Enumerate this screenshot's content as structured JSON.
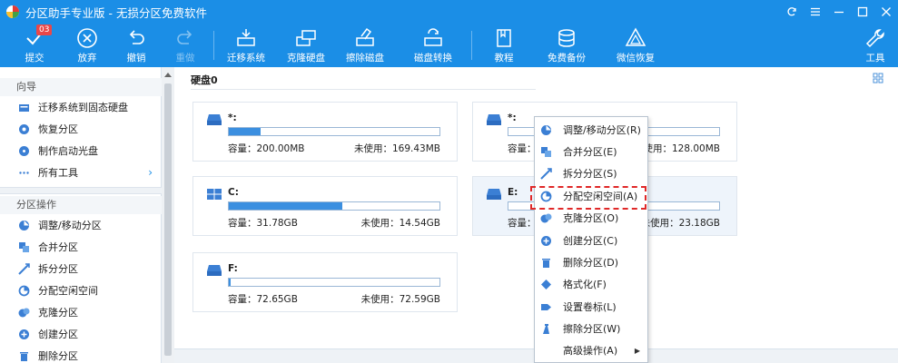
{
  "window": {
    "title": "分区助手专业版 - 无损分区免费软件",
    "accent": "#1b8ee6"
  },
  "toolbar": {
    "commit_label": "提交",
    "commit_badge": "03",
    "discard_label": "放弃",
    "undo_label": "撤销",
    "redo_label": "重做",
    "migrate_label": "迁移系统",
    "clone_disk_label": "克隆硬盘",
    "wipe_disk_label": "擦除磁盘",
    "disk_convert_label": "磁盘转换",
    "tutorial_label": "教程",
    "backup_label": "免费备份",
    "wechat_label": "微信恢复",
    "tools_label": "工具"
  },
  "sidebar": {
    "wizard_title": "向导",
    "wizard_items": [
      {
        "label": "迁移系统到固态硬盘",
        "icon": "migrate-icon"
      },
      {
        "label": "恢复分区",
        "icon": "recover-icon"
      },
      {
        "label": "制作启动光盘",
        "icon": "disc-icon"
      },
      {
        "label": "所有工具",
        "icon": "more-icon"
      }
    ],
    "ops_title": "分区操作",
    "ops_items": [
      {
        "label": "调整/移动分区",
        "icon": "resize-icon"
      },
      {
        "label": "合并分区",
        "icon": "merge-icon"
      },
      {
        "label": "拆分分区",
        "icon": "split-icon"
      },
      {
        "label": "分配空闲空间",
        "icon": "allocate-icon"
      },
      {
        "label": "克隆分区",
        "icon": "clone-icon"
      },
      {
        "label": "创建分区",
        "icon": "create-icon"
      },
      {
        "label": "删除分区",
        "icon": "delete-icon"
      }
    ]
  },
  "main": {
    "disk_title": "硬盘0",
    "partitions": [
      {
        "name": "*:",
        "capacity": "容量：200.00MB",
        "free": "未使用：169.43MB",
        "used_fraction": 0.15
      },
      {
        "name": "*:",
        "capacity": "容量：",
        "free": "未使用：128.00MB",
        "used_fraction": 0.0
      },
      {
        "name": "C:",
        "capacity": "容量：31.78GB",
        "free": "未使用：14.54GB",
        "used_fraction": 0.54
      },
      {
        "name": "E:",
        "capacity": "容量：",
        "free": "未使用：23.18GB",
        "used_fraction": 0.0
      },
      {
        "name": "F:",
        "capacity": "容量：72.65GB",
        "free": "未使用：72.59GB",
        "used_fraction": 0.01
      }
    ]
  },
  "context_menu": {
    "items": [
      {
        "label": "调整/移动分区(R)",
        "icon": "resize-icon"
      },
      {
        "label": "合并分区(E)",
        "icon": "merge-icon"
      },
      {
        "label": "拆分分区(S)",
        "icon": "split-icon"
      },
      {
        "label": "分配空闲空间(A)",
        "icon": "allocate-icon"
      },
      {
        "label": "克隆分区(O)",
        "icon": "clone-icon"
      },
      {
        "label": "创建分区(C)",
        "icon": "create-icon"
      },
      {
        "label": "删除分区(D)",
        "icon": "delete-icon"
      },
      {
        "label": "格式化(F)",
        "icon": "format-icon"
      },
      {
        "label": "设置卷标(L)",
        "icon": "label-icon"
      },
      {
        "label": "擦除分区(W)",
        "icon": "wipe-icon"
      },
      {
        "label": "高级操作(A)",
        "icon": "advanced-icon"
      }
    ],
    "highlighted_index": 3
  }
}
